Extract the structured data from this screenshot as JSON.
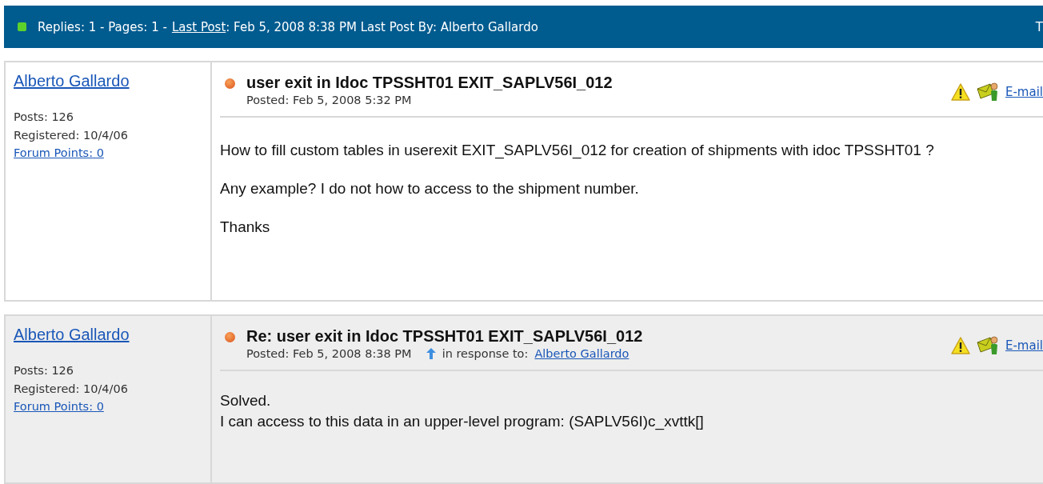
{
  "header": {
    "replies": "Replies: 1 - Pages: 1 -",
    "last_post_link": "Last Post",
    "last_post_info": ": Feb 5, 2008 8:38 PM Last Post By: Alberto Gallardo",
    "right_edge": "T"
  },
  "posts": [
    {
      "shaded": false,
      "author": "Alberto Gallardo",
      "posts": "Posts: 126",
      "registered": "Registered: 10/4/06",
      "points": "Forum Points: 0",
      "title": "user exit in Idoc TPSSHT01 EXIT_SAPLV56I_012",
      "posted": "Posted: Feb 5, 2008 5:32 PM",
      "email": "E-mail",
      "paragraphs": [
        "How to fill custom tables in userexit EXIT_SAPLV56I_012 for creation of shipments with idoc TPSSHT01 ?",
        "Any example? I do not how to access to the shipment number.",
        "Thanks"
      ]
    },
    {
      "shaded": true,
      "author": "Alberto Gallardo",
      "posts": "Posts: 126",
      "registered": "Registered: 10/4/06",
      "points": "Forum Points: 0",
      "title": "Re: user exit in Idoc TPSSHT01 EXIT_SAPLV56I_012",
      "posted": "Posted: Feb 5, 2008 8:38 PM",
      "response_label": "in response to:",
      "response_author": "Alberto Gallardo",
      "email": "E-mail",
      "lines": [
        "Solved.",
        "I can access to this data in an upper-level program: (SAPLV56I)c_xvttk[]"
      ]
    }
  ]
}
